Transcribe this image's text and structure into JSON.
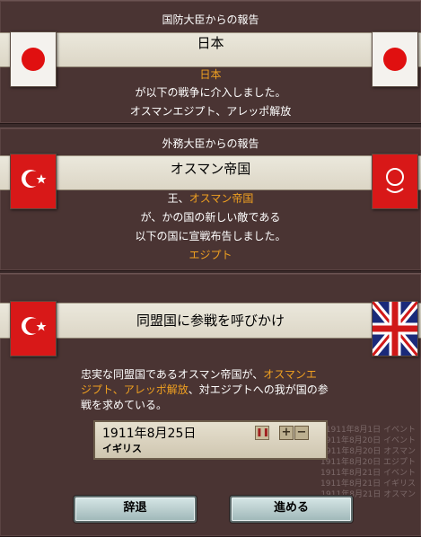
{
  "panel1": {
    "header": "国防大臣からの報告",
    "banner": "日本",
    "lines": [
      "日本",
      "が以下の戦争に介入しました。",
      "オスマンエジプト、アレッポ解放"
    ]
  },
  "panel2": {
    "header": "外務大臣からの報告",
    "banner": "オスマン帝国",
    "line1_prefix": "王、",
    "line1_country": "オスマン帝国",
    "line2": "が、かの国の新しい敵である",
    "line3": "以下の国に宣戦布告しました。",
    "line4": "エジプト"
  },
  "panel3": {
    "banner": "同盟国に参戦を呼びかけ",
    "message_parts": [
      "忠実な同盟国であるオスマン帝国が、",
      "オスマンエジプト、アレッポ解放",
      "、対エジプトへの我が国の参戦を求めている。"
    ],
    "message_line1_plain": "忠実な同盟国であるオスマン帝国が、",
    "message_line1_hl": "オスマンエ",
    "message_line2_hl": "ジプト、アレッポ解放",
    "message_line2_plain": "、対エジプトへの我が国の参",
    "message_line3_plain": "戦を求めている。",
    "date": "1911年8月25日",
    "nation": "イギリス",
    "faded_lines": [
      "1911年8月1日 イベント",
      "1911年8月20日 イベント",
      "1911年8月20日 オスマン",
      "1911年8月20日 エジプト",
      "1911年8月21日 イベント",
      "1911年8月21日 イギリス",
      "1911年8月21日 オスマン"
    ],
    "decline_label": "辞退",
    "accept_label": "進める"
  },
  "colors": {
    "highlight": "#f0a020",
    "panel_bg": "#4a3433",
    "banner_bg": "#e4dfd1"
  }
}
